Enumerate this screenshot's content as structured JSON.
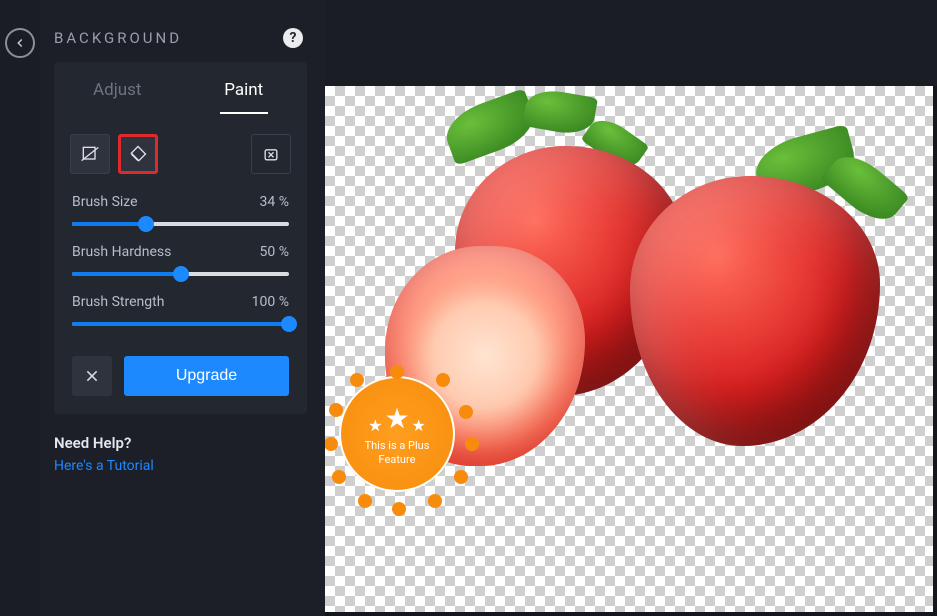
{
  "header": {
    "title": "BACKGROUND"
  },
  "tabs": {
    "adjust": "Adjust",
    "paint": "Paint"
  },
  "sliders": {
    "size": {
      "label": "Brush Size",
      "value": "34 %",
      "pct": 34
    },
    "hardness": {
      "label": "Brush Hardness",
      "value": "50 %",
      "pct": 50
    },
    "strength": {
      "label": "Brush Strength",
      "value": "100 %",
      "pct": 100
    }
  },
  "actions": {
    "upgrade": "Upgrade"
  },
  "help": {
    "title": "Need Help?",
    "link": "Here's a Tutorial"
  },
  "badge": {
    "line1": "This is a Plus",
    "line2": "Feature"
  }
}
